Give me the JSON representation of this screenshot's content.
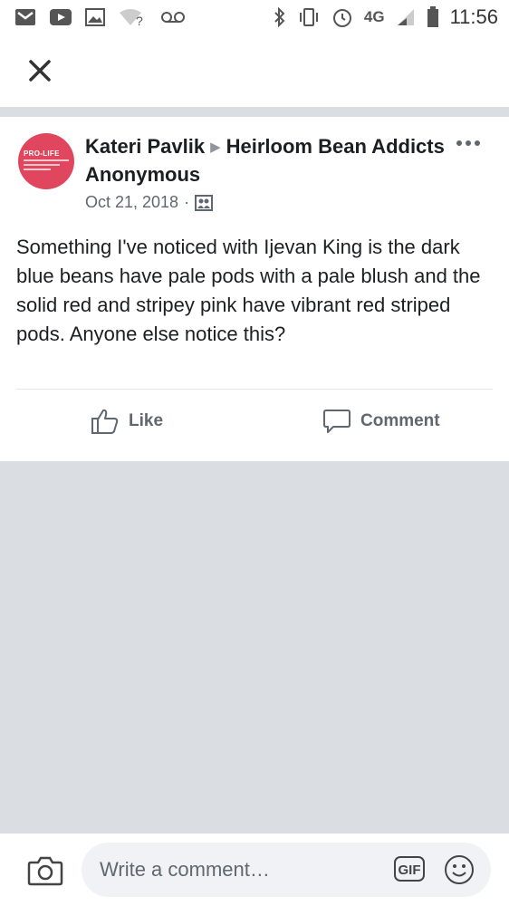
{
  "status_bar": {
    "time": "11:56",
    "network": "4G",
    "icons": [
      "gmail-icon",
      "youtube-icon",
      "photos-icon",
      "wifi-question-icon",
      "voicemail-icon",
      "bluetooth-icon",
      "vibrate-icon",
      "alarm-icon",
      "signal-icon",
      "battery-icon"
    ]
  },
  "navbar": {
    "close_icon": "close-icon"
  },
  "post": {
    "avatar_text": "PRO-LIFE",
    "author": "Kateri Pavlik",
    "group": "Heirloom Bean Addicts Anonymous",
    "date": "Oct 21, 2018",
    "privacy_icon": "group-icon",
    "text": "Something I've noticed with Ijevan King is the dark blue beans have pale pods with a pale blush and the solid red and stripey pink have vibrant red striped pods. Anyone else notice this?",
    "actions": {
      "like_label": "Like",
      "comment_label": "Comment"
    }
  },
  "comment_bar": {
    "placeholder": "Write a comment…",
    "gif_label": "GIF"
  },
  "colors": {
    "divider": "#dadde1",
    "meta_text": "#606770",
    "avatar_bg": "#e0465e"
  }
}
